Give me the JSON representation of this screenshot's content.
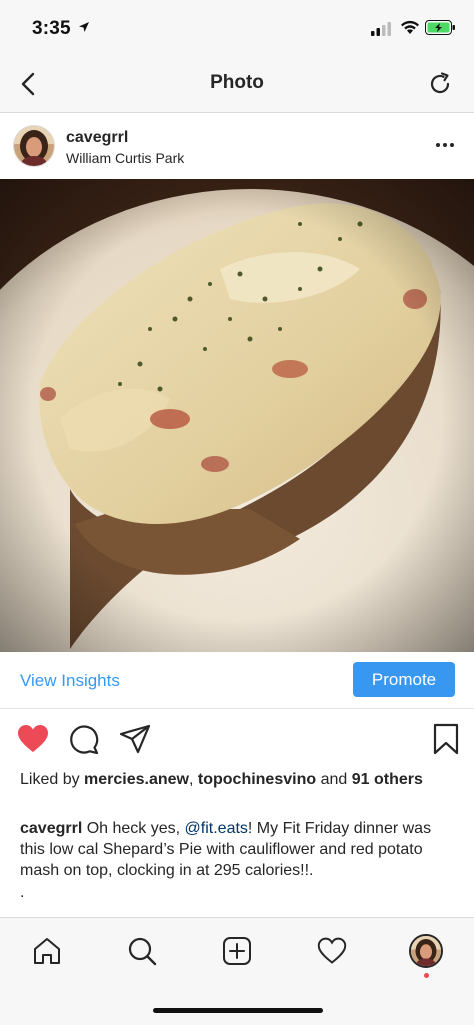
{
  "status_bar": {
    "time": "3:35"
  },
  "nav": {
    "title": "Photo"
  },
  "post": {
    "username": "cavegrrl",
    "location": "William Curtis Park"
  },
  "insights": {
    "link_label": "View Insights",
    "promote_label": "Promote"
  },
  "likes": {
    "prefix": "Liked by ",
    "user1": "mercies.anew",
    "sep": ", ",
    "user2": "topochinesvino",
    "middle": " and ",
    "others": "91 others"
  },
  "caption": {
    "username": "cavegrrl",
    "text_before": " Oh heck yes, ",
    "mention": "@fit.eats",
    "text_after": "! My Fit Friday dinner was this low cal Shepard’s Pie with cauliflower and red potato mash on top, clocking in at 295 calories!!.",
    "dots": "."
  },
  "icons": {
    "like": "heart-filled-icon",
    "comment": "comment-bubble-icon",
    "share": "paper-plane-icon",
    "save": "bookmark-icon",
    "tabs": [
      "home-icon",
      "search-icon",
      "new-post-icon",
      "activity-heart-icon",
      "profile-avatar"
    ]
  },
  "colors": {
    "link": "#3897f0",
    "like": "#ed4956",
    "mention": "#003569",
    "bar_bg": "#f7f7f7"
  }
}
